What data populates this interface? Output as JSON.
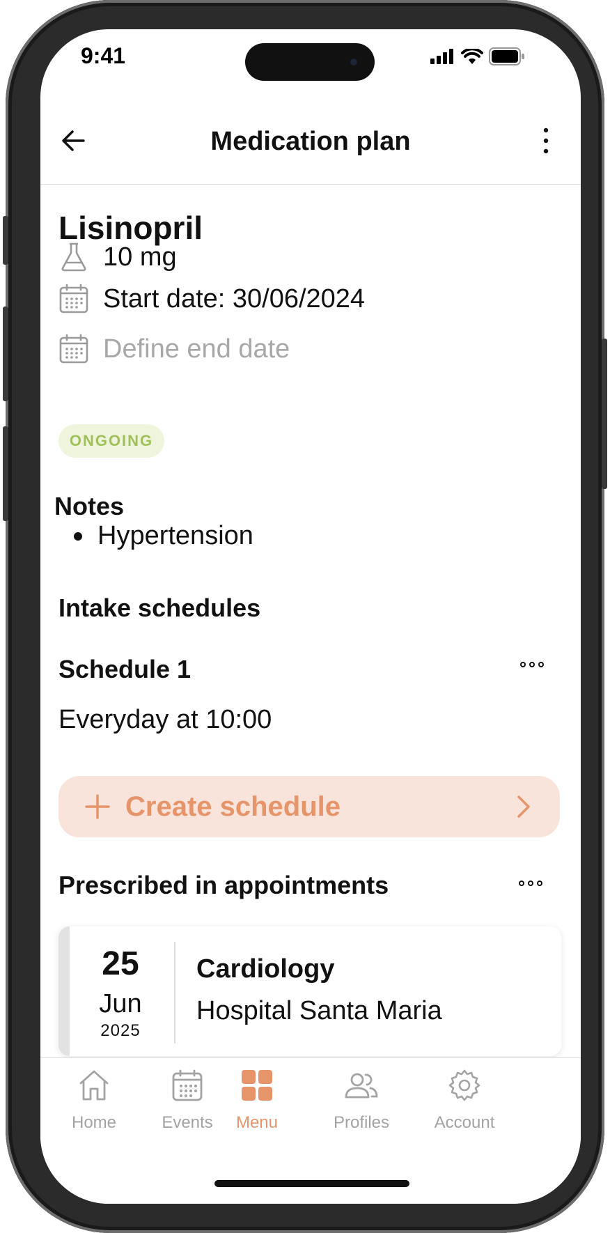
{
  "status_bar": {
    "time": "9:41"
  },
  "header": {
    "title": "Medication plan"
  },
  "medication": {
    "name": "Lisinopril",
    "dose": "10 mg",
    "start_date": "Start date: 30/06/2024",
    "end_date_placeholder": "Define end date",
    "status_badge": "ONGOING"
  },
  "notes": {
    "heading": "Notes",
    "items": [
      "Hypertension"
    ]
  },
  "intake": {
    "heading": "Intake schedules",
    "schedules": [
      {
        "title": "Schedule 1",
        "description": "Everyday at 10:00"
      }
    ],
    "create_label": "Create schedule"
  },
  "appointments": {
    "heading": "Prescribed in appointments",
    "items": [
      {
        "day": "25",
        "month": "Jun",
        "year": "2025",
        "specialty": "Cardiology",
        "location": "Hospital Santa Maria"
      }
    ]
  },
  "tabbar": {
    "items": [
      {
        "label": "Home",
        "icon": "home-icon"
      },
      {
        "label": "Events",
        "icon": "calendar-icon"
      },
      {
        "label": "Menu",
        "icon": "grid-icon",
        "active": true
      },
      {
        "label": "Profiles",
        "icon": "users-icon"
      },
      {
        "label": "Account",
        "icon": "gear-icon"
      }
    ]
  },
  "colors": {
    "accent": "#e6956b",
    "accent_bg": "#f9e4dc",
    "badge_bg": "#eef5dc",
    "badge_text": "#9fc05a",
    "muted": "#a3a3a3"
  }
}
